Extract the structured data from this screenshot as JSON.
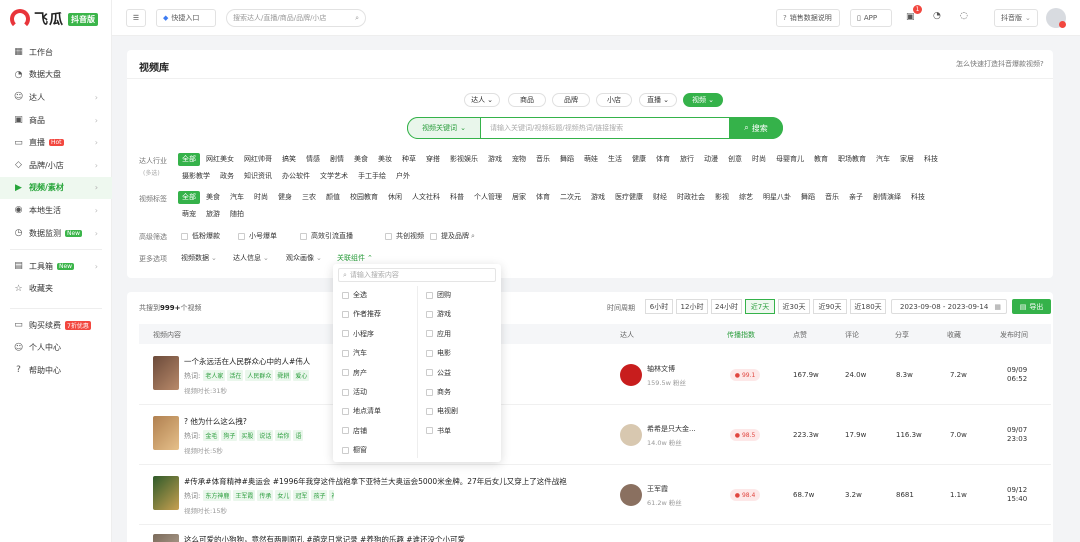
{
  "brand": {
    "name": "飞瓜",
    "badge": "抖音版"
  },
  "sidebar": {
    "items": [
      {
        "label": "工作台",
        "icon": "grid-icon",
        "chevron": false
      },
      {
        "label": "数据大盘",
        "icon": "pie-icon",
        "chevron": false
      },
      {
        "label": "达人",
        "icon": "user-icon",
        "chevron": true
      },
      {
        "label": "商品",
        "icon": "box-icon",
        "chevron": true
      },
      {
        "label": "直播",
        "icon": "monitor-icon",
        "chevron": true,
        "tag": "Hot"
      },
      {
        "label": "品牌/小店",
        "icon": "tag-icon",
        "chevron": true
      },
      {
        "label": "视频/素材",
        "icon": "play-icon",
        "chevron": true,
        "active": true
      },
      {
        "label": "本地生活",
        "icon": "location-icon",
        "chevron": true
      },
      {
        "label": "数据监测",
        "icon": "clock-icon",
        "chevron": true,
        "tag": "New"
      }
    ],
    "items2": [
      {
        "label": "工具箱",
        "icon": "toolbox-icon",
        "chevron": true,
        "tag": "New"
      },
      {
        "label": "收藏夹",
        "icon": "star-icon",
        "chevron": false
      }
    ],
    "items3": [
      {
        "label": "购买续费",
        "icon": "card-icon",
        "tag": "7折优惠"
      },
      {
        "label": "个人中心",
        "icon": "person-icon"
      },
      {
        "label": "帮助中心",
        "icon": "help-icon"
      }
    ]
  },
  "topbar": {
    "menu_icon": "☰",
    "quick_entry": "快捷入口",
    "search_placeholder": "搜索达人/直播/商品/品牌/小店",
    "sales_note": "销售数据说明",
    "app": "APP",
    "notif_count": "1",
    "version": "抖音版"
  },
  "page": {
    "title": "视频库",
    "help_link": "怎么快速打造抖音爆款视频?",
    "type_tabs": [
      {
        "label": "达人",
        "dropdown": true
      },
      {
        "label": "商品"
      },
      {
        "label": "品牌"
      },
      {
        "label": "小店"
      },
      {
        "label": "直播",
        "dropdown": true
      },
      {
        "label": "视频",
        "dropdown": true,
        "active": true
      }
    ],
    "search_mode": "视频关键词",
    "search_placeholder": "请输入关键词/视频标题/视频热词/链接搜索",
    "search_button": "搜索",
    "industry_label": "达人行业",
    "industry_sub": "(多选)",
    "industry_row1": [
      "全部",
      "网红美女",
      "网红帅哥",
      "搞笑",
      "情感",
      "剧情",
      "美食",
      "美妆",
      "种草",
      "穿搭",
      "影视娱乐",
      "游戏",
      "宠物",
      "音乐",
      "舞蹈",
      "萌娃",
      "生活",
      "健康",
      "体育",
      "旅行",
      "动漫",
      "创意",
      "时尚",
      "母婴育儿",
      "教育",
      "职场教育",
      "汽车",
      "家居",
      "科技"
    ],
    "industry_row2": [
      "摄影教学",
      "政务",
      "知识资讯",
      "办公软件",
      "文学艺术",
      "手工手绘",
      "户外"
    ],
    "tag_label": "视频标签",
    "tag_row1": [
      "全部",
      "美食",
      "汽车",
      "时尚",
      "健身",
      "三农",
      "颜值",
      "校园教育",
      "休闲",
      "人文社科",
      "科普",
      "个人管理",
      "居家",
      "体育",
      "二次元",
      "游戏",
      "医疗健康",
      "财经",
      "时政社会",
      "影视",
      "综艺",
      "明星八卦",
      "舞蹈",
      "音乐",
      "亲子",
      "剧情演绎",
      "科技"
    ],
    "tag_row2": [
      "萌宠",
      "旅游",
      "随拍"
    ],
    "adv_label": "高级筛选",
    "adv_options": [
      "低粉爆款",
      "小号爆单",
      "高效引流直播",
      "共创视频",
      "提及品牌"
    ],
    "more_label": "更多选项",
    "more_options": [
      "视频数据",
      "达人信息",
      "观众画像",
      "关联组件"
    ],
    "total_prefix": "共搜到",
    "total_count": "999+",
    "total_suffix": "个视频",
    "period_label": "时间周期",
    "periods": [
      "6小时",
      "12小时",
      "24小时",
      "近7天",
      "近30天",
      "近90天",
      "近180天"
    ],
    "active_period": "近7天",
    "date_range": "2023-09-08 - 2023-09-14",
    "export": "导出"
  },
  "table": {
    "headers": [
      "视频内容",
      "达人",
      "传播指数",
      "点赞",
      "评论",
      "分享",
      "收藏",
      "发布时间"
    ],
    "hot_label": "热词:",
    "duration_label": "视频时长:",
    "fans_label": "粉丝",
    "rows": [
      {
        "title": "一个永远活在人民群众心中的人#伟人",
        "keywords": [
          "老人家",
          "活在",
          "人民群众",
          "舜耕",
          "爱心"
        ],
        "duration": "31秒",
        "author": "轴林文博",
        "fans": "159.5w",
        "heat": "99.1",
        "likes": "167.9w",
        "comments": "24.0w",
        "shares": "8.3w",
        "favs": "7.2w",
        "date": "09/09",
        "time": "06:52"
      },
      {
        "title": "? 他为什么这么拽?",
        "keywords": [
          "金毛",
          "狗子",
          "买股",
          "说话",
          "给你",
          "语"
        ],
        "duration": "5秒",
        "author": "希希是只大金...",
        "fans": "14.0w",
        "heat": "98.5",
        "likes": "223.3w",
        "comments": "17.9w",
        "shares": "116.3w",
        "favs": "7.0w",
        "date": "09/07",
        "time": "23:03"
      },
      {
        "title": "#传承#体育精神#奥运会 #1996年我穿这件战袍拿下亚特兰大奥运会5000米金牌。27年后女儿又穿上了这件战袍",
        "keywords": [
          "东方神鹿",
          "王军霞",
          "传承",
          "女儿",
          "冠军",
          "孩子",
          "神鹿",
          "衣服",
          "记得",
          "后继有人"
        ],
        "duration": "15秒",
        "author": "王军霞",
        "fans": "61.2w",
        "heat": "98.4",
        "likes": "68.7w",
        "comments": "3.2w",
        "shares": "8681",
        "favs": "1.1w",
        "date": "09/12",
        "time": "15:40"
      },
      {
        "title": "这么可爱的小狗狗，竟然有两副面孔 #萌宠日常记录 #养狗的乐趣 #谁还没个小可爱"
      }
    ]
  },
  "dropdown": {
    "search_placeholder": "请输入搜索内容",
    "left": [
      "全选",
      "作者推荐",
      "小程序",
      "汽车",
      "房产",
      "活动",
      "地点清单",
      "店铺",
      "橱窗"
    ],
    "right": [
      "团购",
      "游戏",
      "应用",
      "电影",
      "公益",
      "商务",
      "电视剧",
      "书单"
    ]
  },
  "colors": {
    "accent": "#35b24a",
    "hot": "#f2473f"
  }
}
